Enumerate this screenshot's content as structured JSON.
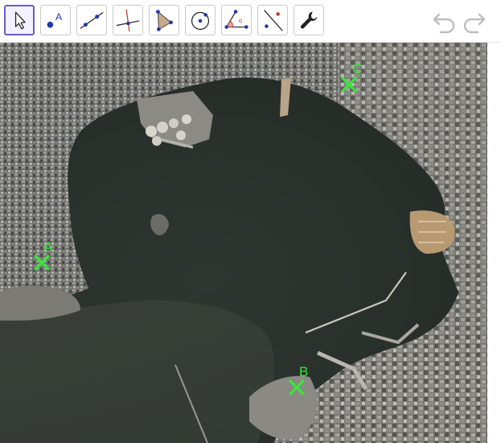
{
  "toolbar": {
    "tools": [
      {
        "name": "move-tool",
        "icon": "pointer-arrow-icon",
        "selected": true
      },
      {
        "name": "point-tool",
        "icon": "point-icon",
        "letter": "A",
        "selected": false
      },
      {
        "name": "line-tool",
        "icon": "line-through-points-icon",
        "selected": false
      },
      {
        "name": "perpendicular-line-tool",
        "icon": "perpendicular-line-icon",
        "selected": false
      },
      {
        "name": "polygon-tool",
        "icon": "polygon-icon",
        "selected": false
      },
      {
        "name": "circle-tool",
        "icon": "circle-center-point-icon",
        "selected": false
      },
      {
        "name": "angle-tool",
        "icon": "angle-icon",
        "selected": false
      },
      {
        "name": "reflect-tool",
        "icon": "reflect-about-line-icon",
        "selected": false
      },
      {
        "name": "settings-tool",
        "icon": "wrench-icon",
        "selected": false
      }
    ],
    "undo_icon": "undo-icon",
    "redo_icon": "redo-icon"
  },
  "canvas": {
    "background": "satellite-harbor-map",
    "points": [
      {
        "label": "A",
        "color": "#39e639"
      },
      {
        "label": "B",
        "color": "#39e639"
      },
      {
        "label": "C",
        "color": "#39e639"
      }
    ]
  },
  "colors": {
    "accent": "#6a5acd",
    "point": "#39e639",
    "water": "#2b322c",
    "tool_blue": "#1f3aa8"
  }
}
